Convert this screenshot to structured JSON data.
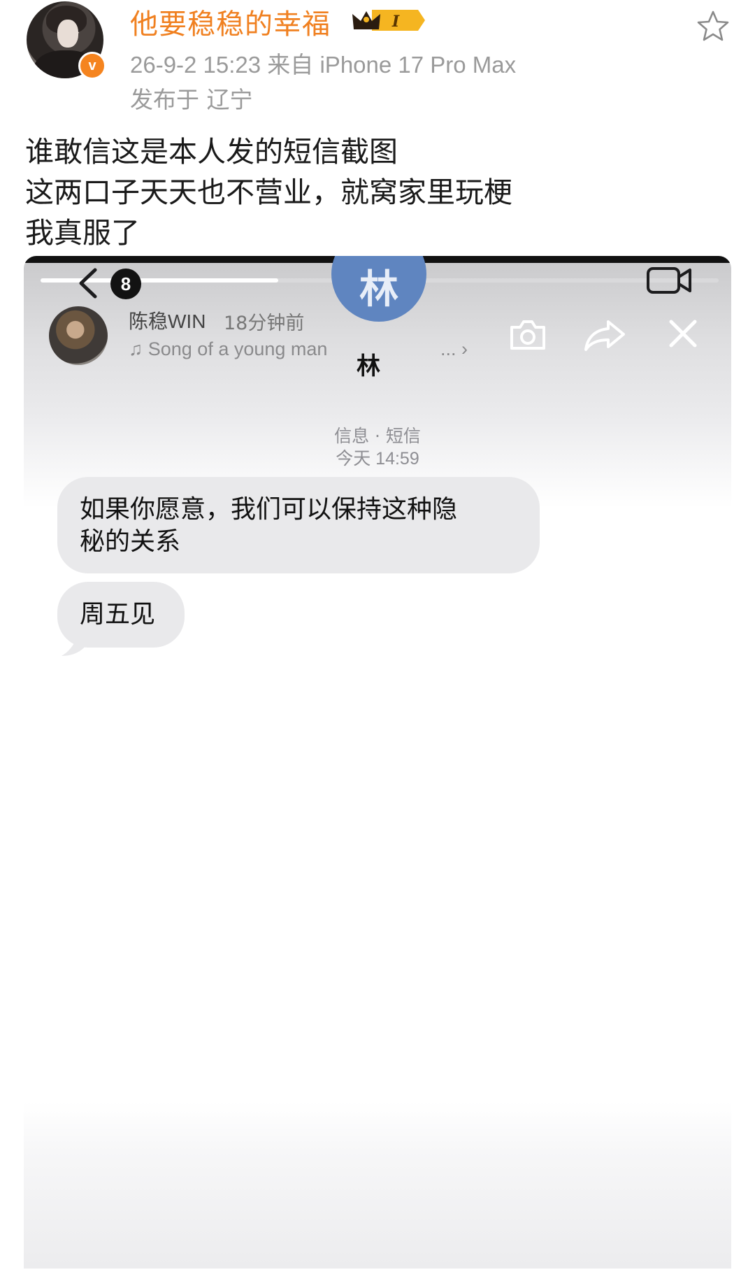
{
  "post": {
    "username": "他要稳稳的幸福",
    "vip_level": "I",
    "verified_mark": "v",
    "time_source": "26-9-2 15:23  来自 iPhone 17 Pro Max",
    "location": "发布于 辽宁",
    "text_lines": [
      "谁敢信这是本人发的短信截图",
      "这两口子天天也不营业，就窝家里玩梗",
      "我真服了"
    ]
  },
  "screenshot": {
    "story": {
      "user": "陈稳WIN",
      "time_ago": "18分钟前",
      "song": "♫ Song of a young man",
      "more": "... ›",
      "progress": 0.35
    },
    "sms": {
      "unread_count": "8",
      "contact_initial": "林",
      "contact_name": "林",
      "channel": "信息 · 短信",
      "timestamp": "今天 14:59",
      "messages": [
        {
          "text_line1": "如果你愿意，我们可以保持这种隐",
          "text_line2": "秘的关系"
        },
        {
          "text": "周五见"
        }
      ]
    }
  },
  "icons": {
    "favorite": "star-outline-icon",
    "back": "chevron-left-icon",
    "video": "video-camera-icon",
    "camera": "camera-icon",
    "share": "share-arrow-icon",
    "close": "close-x-icon",
    "crown": "crown-icon"
  },
  "colors": {
    "username": "#f08020",
    "meta": "#9a9a9a",
    "vip_badge": "#f5b521",
    "bubble": "#e9e9eb",
    "contact_avatar": "#5f85c0"
  }
}
